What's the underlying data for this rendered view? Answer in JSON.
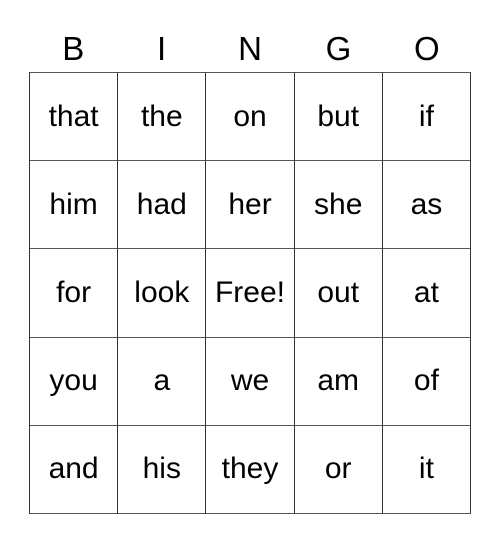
{
  "card": {
    "title": "BINGO",
    "background_color": "#ffffff",
    "text_color": "#000000",
    "border_color": "#333333",
    "headers": [
      "B",
      "I",
      "N",
      "G",
      "O"
    ],
    "rows": [
      [
        "that",
        "the",
        "on",
        "but",
        "if"
      ],
      [
        "him",
        "had",
        "her",
        "she",
        "as"
      ],
      [
        "for",
        "look",
        "Free!",
        "out",
        "at"
      ],
      [
        "you",
        "a",
        "we",
        "am",
        "of"
      ],
      [
        "and",
        "his",
        "they",
        "or",
        "it"
      ]
    ],
    "free_space": {
      "label": "Free!",
      "row_index": 2,
      "column_index": 2
    }
  }
}
